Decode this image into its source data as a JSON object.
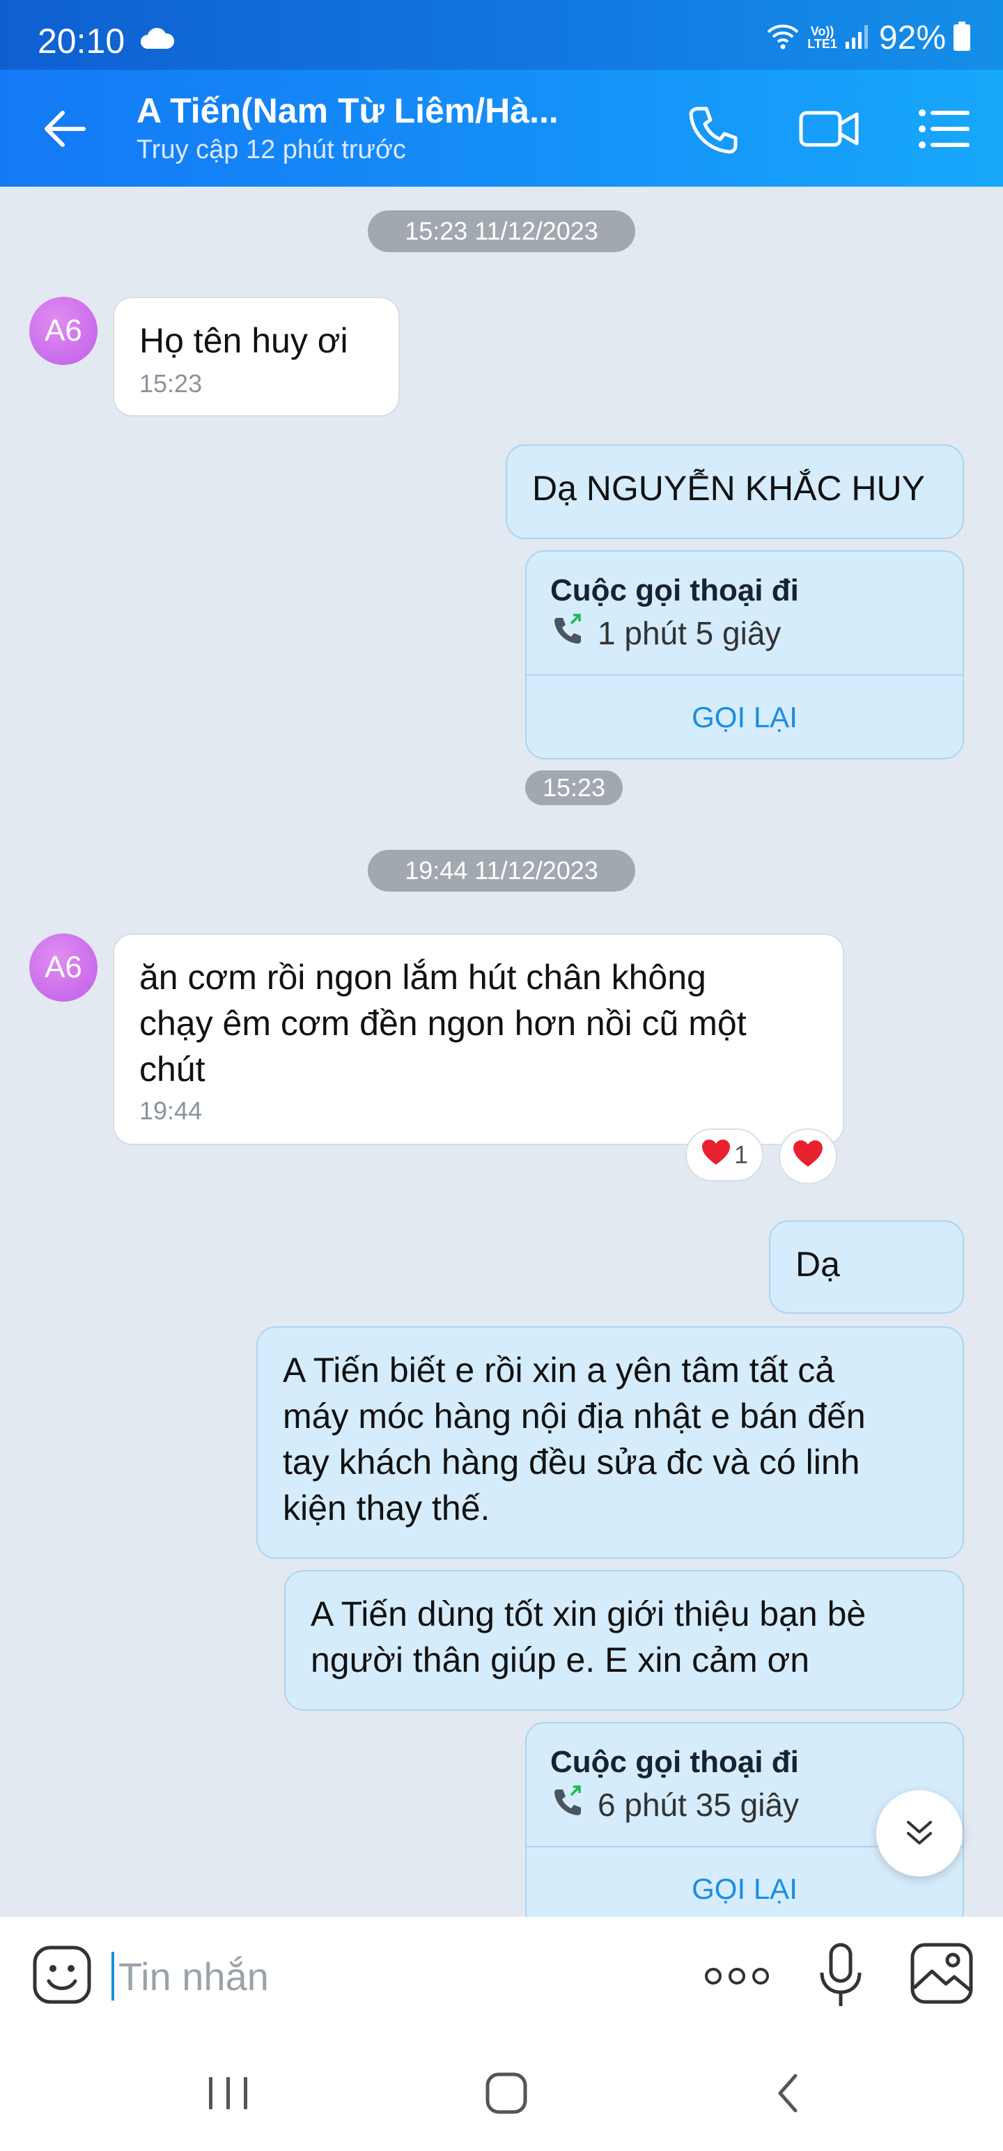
{
  "status_bar": {
    "time": "20:10",
    "battery": "92%",
    "volte_top": "Vo))",
    "volte_bottom": "LTE1"
  },
  "header": {
    "title": "A Tiến(Nam Từ Liêm/Hà...",
    "subtitle": "Truy cập 12 phút trước",
    "icons": [
      "back-arrow-icon",
      "phone-icon",
      "video-call-icon",
      "menu-list-icon"
    ]
  },
  "chat": {
    "date_chip_1": "15:23 11/12/2023",
    "msg1": {
      "avatar": "A6",
      "text": "Họ tên huy ơi",
      "time": "15:23"
    },
    "msg2": {
      "text": "Dạ NGUYỄN KHẮC HUY"
    },
    "call1": {
      "title": "Cuộc gọi thoại đi",
      "duration": "1 phút 5 giây",
      "action": "GỌI LẠI"
    },
    "time_chip_1": "15:23",
    "date_chip_2": "19:44 11/12/2023",
    "msg3": {
      "avatar": "A6",
      "lines": [
        "ăn cơm rồi ngon lắm hút chân không",
        "chạy êm cơm đền ngon hơn nồi cũ một",
        "chút"
      ],
      "time": "19:44",
      "reaction_count": "1"
    },
    "msg4": {
      "text": "Dạ"
    },
    "msg5": {
      "lines": [
        "A Tiến biết e rồi xin a yên tâm tất cả",
        "máy móc hàng nội địa nhật e bán đến",
        "tay khách hàng đều sửa đc và có linh",
        "kiện thay thế."
      ]
    },
    "msg6": {
      "lines": [
        "A Tiến dùng tốt xin giới thiệu bạn bè",
        "người thân giúp e. E xin cảm ơn"
      ]
    },
    "call2": {
      "title": "Cuộc gọi thoại đi",
      "duration": "6 phút 35 giây",
      "action": "GỌI LẠI"
    }
  },
  "composer": {
    "placeholder": "Tin nhắn"
  },
  "colors": {
    "header": "#1590f8",
    "outgoing_bubble": "#d5ecfd",
    "incoming_bubble": "#ffffff",
    "accent": "#1a8de0",
    "heart": "#e8212f"
  }
}
